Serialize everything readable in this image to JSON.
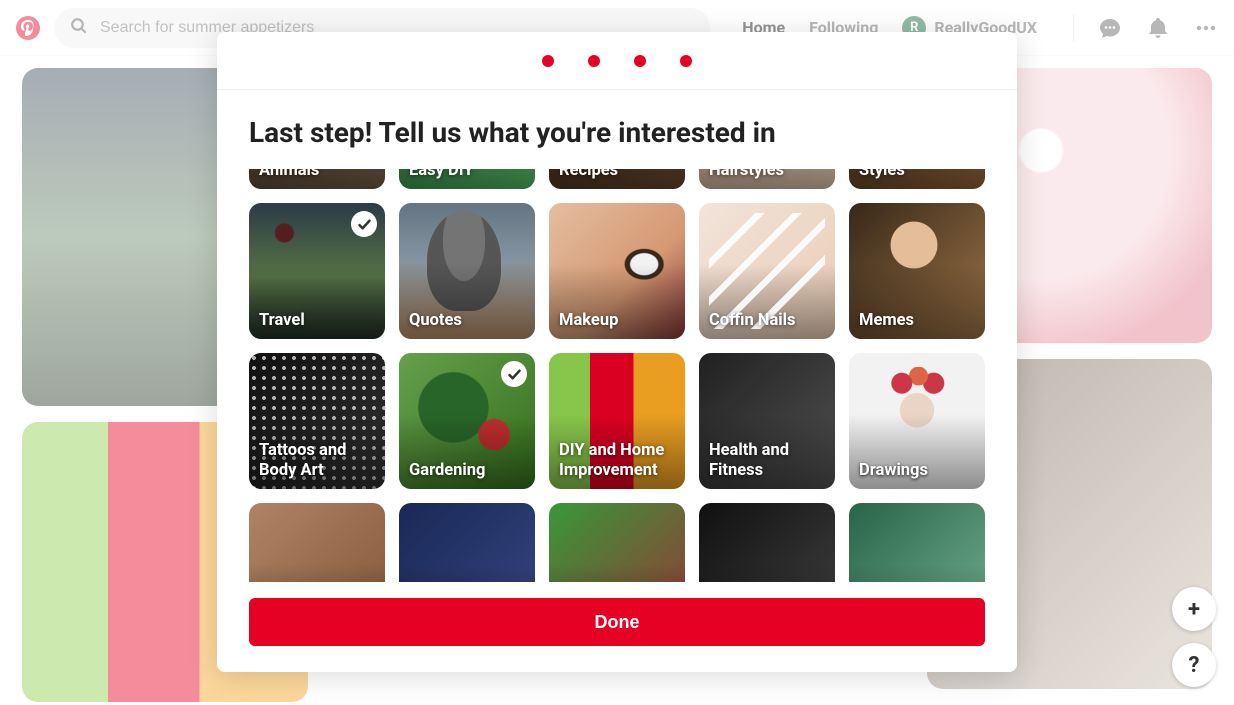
{
  "header": {
    "search_placeholder": "Search for summer appetizers",
    "nav": {
      "home": "Home",
      "following": "Following"
    },
    "profile": {
      "initial": "R",
      "name": "ReallyGoodUX"
    }
  },
  "modal": {
    "step_count": 4,
    "title": "Last step! Tell us what you're interested in",
    "done_label": "Done",
    "interests": {
      "row_top": [
        {
          "label": "Animals",
          "selected": false
        },
        {
          "label": "Easy DIY",
          "selected": false
        },
        {
          "label": "Recipes",
          "selected": false
        },
        {
          "label": "Hairstyles",
          "selected": false
        },
        {
          "label": "Styles",
          "selected": false
        }
      ],
      "row1": [
        {
          "label": "Travel",
          "selected": true
        },
        {
          "label": "Quotes",
          "selected": false
        },
        {
          "label": "Makeup",
          "selected": false
        },
        {
          "label": "Coffin Nails",
          "selected": false
        },
        {
          "label": "Memes",
          "selected": false
        }
      ],
      "row2": [
        {
          "label": "Tattoos and Body Art",
          "selected": false
        },
        {
          "label": "Gardening",
          "selected": true
        },
        {
          "label": "DIY and Home Improvement",
          "selected": false
        },
        {
          "label": "Health and Fitness",
          "selected": false
        },
        {
          "label": "Drawings",
          "selected": false
        }
      ]
    }
  },
  "colors": {
    "brand_red": "#e60023"
  },
  "fab": {
    "add": "+",
    "help": "?"
  }
}
